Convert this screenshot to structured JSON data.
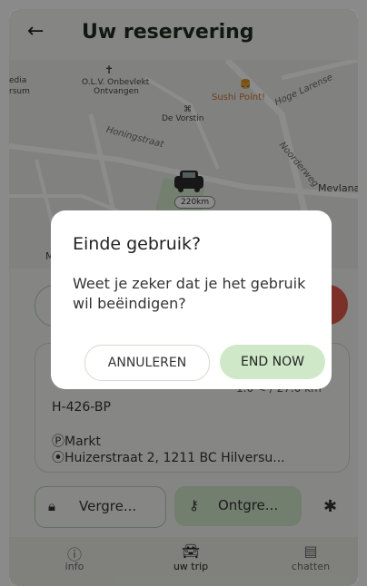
{
  "header": {
    "back_icon": "arrow-left-icon",
    "title": "Uw reservering"
  },
  "map": {
    "labels": {
      "media": "edia",
      "hilversum": "rsum",
      "church": "O.L.V. Onbevlekt",
      "church2": "Ontvangen",
      "devorstin": "De Vorstin",
      "sushi": "Sushi Point!",
      "hoge": "Hoge Larense",
      "honingstraat": "Honingstraat",
      "noorderweg": "Noorderweg",
      "mevlana": "Mevlana",
      "m": "M"
    },
    "distance_badge": "220km"
  },
  "card": {
    "plate": "H-426-BP",
    "distance": "1.0 < / 27.0 km",
    "parking_name": "ⓅMarkt",
    "address": "Huizerstraat 2, 1211 BC Hilversu..."
  },
  "actions": {
    "lock_label": "Vergre...",
    "unlock_label": "Ontgre..."
  },
  "nav": {
    "items": [
      {
        "label": "info",
        "icon": "info-icon"
      },
      {
        "label": "uw trip",
        "icon": "car-icon"
      },
      {
        "label": "chatten",
        "icon": "chat-icon"
      }
    ]
  },
  "dialog": {
    "title": "Einde gebruik?",
    "message": "Weet je zeker dat je het gebruik wil beëindigen?",
    "cancel_label": "ANNULEREN",
    "confirm_label": "END NOW"
  },
  "colors": {
    "accent_green": "#cfe8c8",
    "danger_red": "#e05a4e",
    "background": "#f3f5ee"
  }
}
